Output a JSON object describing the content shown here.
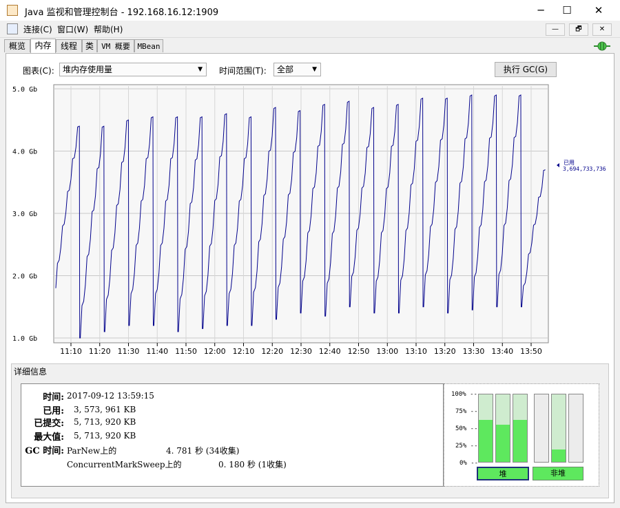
{
  "window": {
    "title": "Java 监视和管理控制台 - 192.168.16.12:1909",
    "minimize": "─",
    "maximize": "☐",
    "close": "✕"
  },
  "menu": {
    "items": [
      "连接(C)",
      "窗口(W)",
      "帮助(H)"
    ]
  },
  "mdi": {
    "minimize": "—",
    "restore": "🗗",
    "close": "✕"
  },
  "tabs": [
    {
      "label": "概览",
      "active": false
    },
    {
      "label": "内存",
      "active": true
    },
    {
      "label": "线程",
      "active": false
    },
    {
      "label": "类",
      "active": false
    },
    {
      "label": "VM 概要",
      "active": false
    },
    {
      "label": "MBean",
      "active": false
    }
  ],
  "controls": {
    "chart_label": "图表(C):",
    "chart_value": "堆内存使用量",
    "range_label": "时间范围(T):",
    "range_value": "全部",
    "gc_button": "执行 GC(G)"
  },
  "chart_data": {
    "type": "line",
    "x_ticks": [
      "11:10",
      "11:20",
      "11:30",
      "11:40",
      "11:50",
      "12:00",
      "12:10",
      "12:20",
      "12:30",
      "12:40",
      "12:50",
      "13:00",
      "13:10",
      "13:20",
      "13:30",
      "13:40",
      "13:50"
    ],
    "y_ticks": [
      "1.0 Gb",
      "2.0 Gb",
      "3.0 Gb",
      "4.0 Gb",
      "5.0 Gb"
    ],
    "ylim": [
      1.0,
      5.0
    ],
    "line_color": "#00008b",
    "series_label": "已用",
    "series_value": "3,694,733,736",
    "cycles": [
      {
        "start": 1.8,
        "peak": 4.4
      },
      {
        "start": 1.0,
        "peak": 4.4
      },
      {
        "start": 1.1,
        "peak": 4.5
      },
      {
        "start": 1.2,
        "peak": 4.55
      },
      {
        "start": 1.2,
        "peak": 4.55
      },
      {
        "start": 1.1,
        "peak": 4.55
      },
      {
        "start": 1.15,
        "peak": 4.6
      },
      {
        "start": 1.2,
        "peak": 4.55
      },
      {
        "start": 1.2,
        "peak": 4.7
      },
      {
        "start": 1.3,
        "peak": 4.65
      },
      {
        "start": 1.4,
        "peak": 4.75
      },
      {
        "start": 1.35,
        "peak": 4.8
      },
      {
        "start": 1.5,
        "peak": 4.7
      },
      {
        "start": 1.4,
        "peak": 4.75
      },
      {
        "start": 1.4,
        "peak": 4.85
      },
      {
        "start": 1.5,
        "peak": 4.85
      },
      {
        "start": 1.4,
        "peak": 4.9
      },
      {
        "start": 1.45,
        "peak": 4.9
      },
      {
        "start": 1.5,
        "peak": 4.9
      },
      {
        "start": 1.5,
        "peak": 3.7
      }
    ]
  },
  "details": {
    "title": "详细信息",
    "time_label": "时间:",
    "time_value": "2017-09-12 13:59:15",
    "used_label": "已用:",
    "used_value": "3, 573, 961 KB",
    "committed_label": "已提交:",
    "committed_value": "5, 713, 920 KB",
    "max_label": "最大值:",
    "max_value": "5, 713, 920 KB",
    "gc_label": "GC 时间:",
    "gc1_name": "ParNew上的",
    "gc1_value": "4. 781 秒 (34收集)",
    "gc2_name": "ConcurrentMarkSweep上的",
    "gc2_value": "0. 180 秒 (1收集)"
  },
  "pools": {
    "axis": [
      "100% --",
      "75% --",
      "50% --",
      "25% --",
      "0% --"
    ],
    "heap_label": "堆",
    "nonheap_label": "非堆",
    "heap_bars": [
      0.62,
      0.55,
      0.62
    ],
    "nonheap_bars": [
      0.0,
      0.18,
      0.0
    ],
    "fill_color": "#5ee85e",
    "bg_color": "#cfeccf"
  }
}
